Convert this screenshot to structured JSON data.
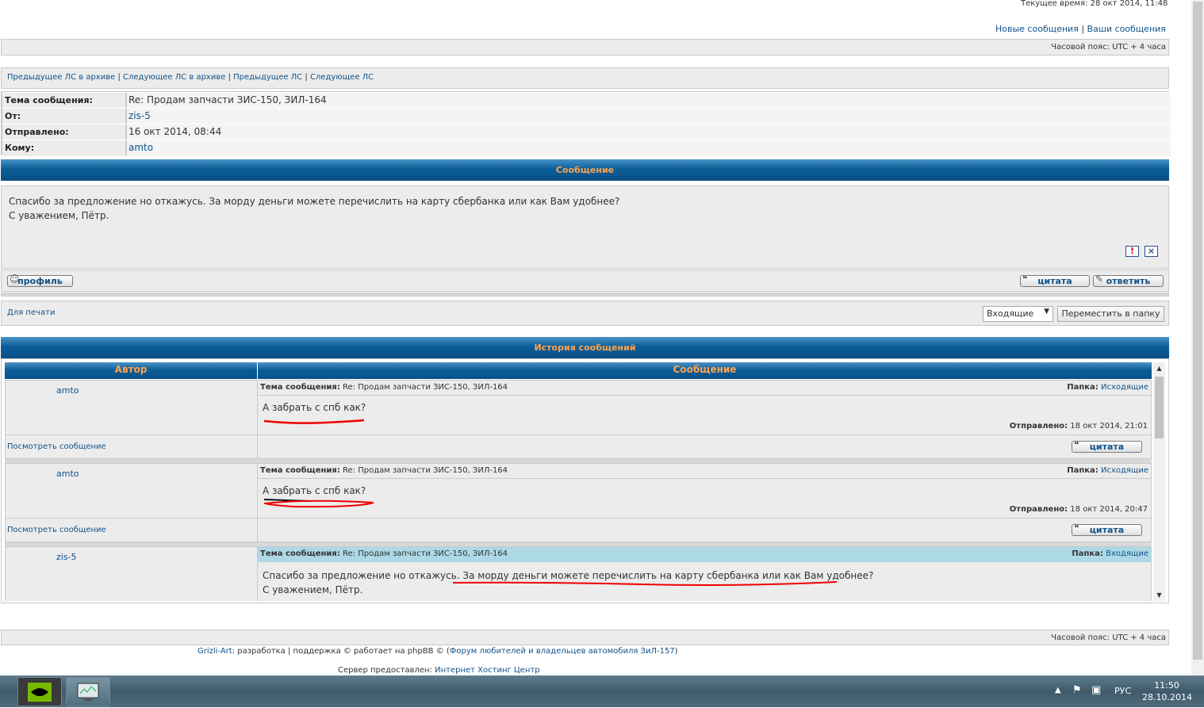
{
  "top": {
    "current_time": "Текущее время: 28 окт 2014, 11:48",
    "new_messages": "Новые сообщения",
    "separator": "|",
    "your_messages": "Ваши сообщения",
    "timezone": "Часовой пояс: UTC + 4 часа"
  },
  "nav": {
    "prev_archive": "Предыдущее ЛС в архиве",
    "next_archive": "Следующее ЛС в архиве",
    "prev": "Предыдущее ЛС",
    "next": "Следующее ЛС",
    "sep": "|"
  },
  "meta": {
    "subject_label": "Тема сообщения:",
    "subject_value": "Re: Продам запчасти ЗИС-150, ЗИЛ-164",
    "from_label": "От:",
    "from_value": "zis-5",
    "sent_label": "Отправлено:",
    "sent_value": "16 окт 2014, 08:44",
    "to_label": "Кому:",
    "to_value": "amto"
  },
  "message": {
    "header": "Сообщение",
    "line1": "Спасибо за предложение но откажусь. За морду деньги можете перечислить на карту сбербанка или как Вам удобнее?",
    "line2": "С уважением, Пётр.",
    "report_icon": "!",
    "delete_icon": "×",
    "profile_btn": "профиль",
    "quote_btn": "цитата",
    "reply_btn": "ответить"
  },
  "actions": {
    "print_link": "Для печати",
    "folder_select": "Входящие",
    "move_btn": "Переместить в папку"
  },
  "history": {
    "header": "История сообщений",
    "col_author": "Автор",
    "col_message": "Сообщение",
    "subject_label": "Тема сообщения:",
    "folder_label": "Папка:",
    "sent_label": "Отправлено:",
    "view_link": "Посмотреть сообщение",
    "quote_btn": "цитата",
    "items": [
      {
        "author": "amto",
        "subject": "Re: Продам запчасти ЗИС-150, ЗИЛ-164",
        "folder": "Исходящие",
        "text": "А забрать с спб как?",
        "sent": "18 окт 2014, 21:01"
      },
      {
        "author": "amto",
        "subject": "Re: Продам запчасти ЗИС-150, ЗИЛ-164",
        "folder": "Исходящие",
        "text": "А забрать с спб как?",
        "sent": "18 окт 2014, 20:47"
      },
      {
        "author": "zis-5",
        "subject": "Re: Продам запчасти ЗИС-150, ЗИЛ-164",
        "folder": "Входящие",
        "text_a": "Спасибо за предложение но откажусь. ",
        "text_b": "За морду деньги можете перечислить на карту сбербанка или как Вам удобнее?",
        "text2": "С уважением, Пётр."
      }
    ]
  },
  "footer": {
    "timezone": "Часовой пояс: UTC + 4 часа",
    "grizli": "Grizli-Art",
    "dev": ": разработка | поддержка © работает на phpBB © (",
    "forum": "Форум любителей и владельцев автомобиля ЗиЛ-157",
    "close": ")",
    "server_label": "Сервер предоставлен:",
    "server_link": "Интернет Хостинг Центр"
  },
  "taskbar": {
    "lang": "РУС",
    "time": "11:50",
    "date": "28.10.2014"
  },
  "colors": {
    "link": "#105289",
    "header_text": "#ffa34f",
    "header_bg": "#0b5e99",
    "annotation": "#e00000"
  }
}
